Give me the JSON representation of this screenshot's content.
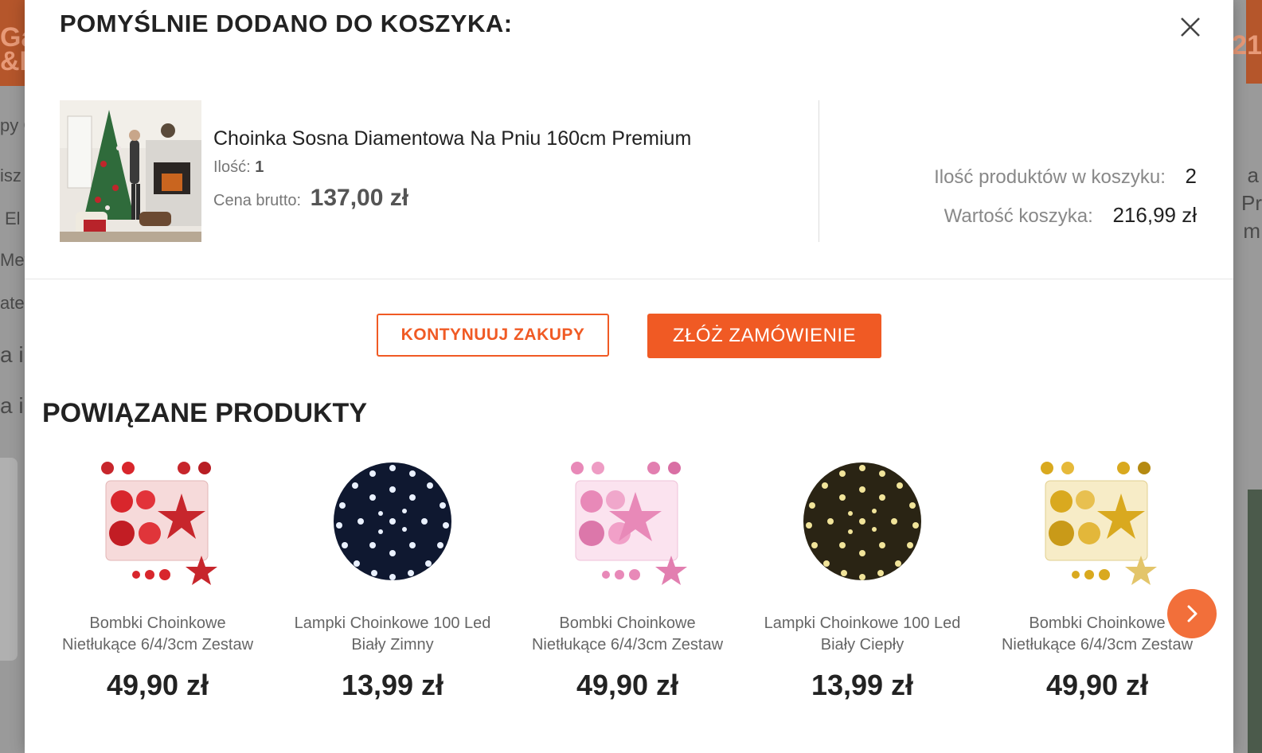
{
  "background": {
    "left_snippets": [
      "Ga",
      "&H",
      "py C",
      "isz",
      "El",
      "Met",
      "ater",
      "a i",
      "a i"
    ],
    "right_snippets": [
      "21",
      "a",
      "Pr",
      "m"
    ]
  },
  "modal": {
    "title": "POMYŚLNIE DODANO DO KOSZYKA:",
    "close_icon": "close-icon",
    "added_product": {
      "name": "Choinka Sosna Diamentowa Na Pniu 160cm Premium",
      "quantity_label": "Ilość:",
      "quantity_value": "1",
      "price_label": "Cena brutto:",
      "price_value": "137,00 zł"
    },
    "summary": {
      "count_label": "Ilość produktów w koszyku:",
      "count_value": "2",
      "total_label": "Wartość koszyka:",
      "total_value": "216,99 zł"
    },
    "buttons": {
      "continue_label": "KONTYNUUJ ZAKUPY",
      "order_label": "ZŁÓŻ ZAMÓWIENIE"
    },
    "related": {
      "title": "POWIĄZANE PRODUKTY",
      "items": [
        {
          "name_line1": "Bombki Choinkowe",
          "name_line2": "Nietłukące 6/4/3cm Zestaw",
          "price": "49,90 zł",
          "image": "red-baubles-set",
          "color": "#d8262c"
        },
        {
          "name_line1": "Lampki Choinkowe 100 Led",
          "name_line2": "Biały Zimny",
          "price": "13,99 zł",
          "image": "cold-white-led-lights",
          "color": "#e8f0ff"
        },
        {
          "name_line1": "Bombki Choinkowe",
          "name_line2": "Nietłukące 6/4/3cm Zestaw",
          "price": "49,90 zł",
          "image": "pink-baubles-set",
          "color": "#e889b8"
        },
        {
          "name_line1": "Lampki Choinkowe 100 Led",
          "name_line2": "Biały Ciepły",
          "price": "13,99 zł",
          "image": "warm-white-led-lights",
          "color": "#f1e49a"
        },
        {
          "name_line1": "Bombki Choinkowe",
          "name_line2": "Nietłukące 6/4/3cm Zestaw",
          "price": "49,90 zł",
          "image": "gold-baubles-set",
          "color": "#d9a91f"
        }
      ],
      "next_icon": "chevron-right-icon"
    },
    "accent_color": "#f05a24"
  }
}
